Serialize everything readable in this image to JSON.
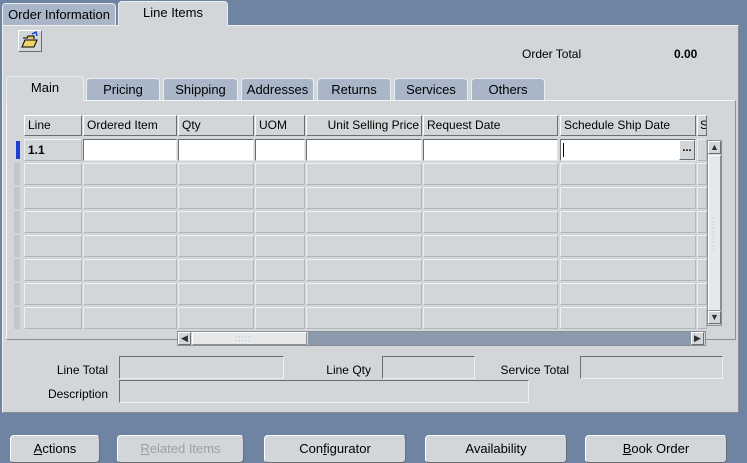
{
  "outer_tabs": [
    {
      "label": "Order Information",
      "active": false
    },
    {
      "label": "Line Items",
      "active": true
    }
  ],
  "toolbar": {
    "folder_icon": "open-folder-icon"
  },
  "order_total": {
    "label": "Order Total",
    "value": "0.00"
  },
  "inner_tabs": [
    {
      "label": "Main",
      "active": true
    },
    {
      "label": "Pricing"
    },
    {
      "label": "Shipping"
    },
    {
      "label": "Addresses"
    },
    {
      "label": "Returns"
    },
    {
      "label": "Services"
    },
    {
      "label": "Others"
    }
  ],
  "grid": {
    "columns": [
      "Line",
      "Ordered Item",
      "Qty",
      "UOM",
      "Unit Selling Price",
      "Request Date",
      "Schedule Ship Date",
      "S"
    ],
    "first_row": {
      "line": "1.1",
      "ordered_item": "",
      "qty": "",
      "uom": "",
      "unit_selling_price": "",
      "request_date": "",
      "schedule_ship_date": ""
    },
    "lov_button": "...",
    "empty_rows": 7
  },
  "footer_fields": {
    "line_total_label": "Line Total",
    "line_qty_label": "Line Qty",
    "service_total_label": "Service Total",
    "description_label": "Description",
    "line_total": "",
    "line_qty": "",
    "service_total": "",
    "description": ""
  },
  "buttons": {
    "actions": {
      "pre": "",
      "u": "A",
      "post": "ctions"
    },
    "related_items": {
      "pre": "",
      "u": "R",
      "post": "elated Items",
      "disabled": true
    },
    "configurator": {
      "pre": "Con",
      "u": "f",
      "post": "igurator"
    },
    "availability": {
      "pre": "Availability",
      "u": "",
      "post": ""
    },
    "book_order": {
      "pre": "",
      "u": "B",
      "post": "ook Order"
    }
  },
  "colors": {
    "background": "#6f83a2",
    "panel": "#d3d6d8",
    "tab_inactive": "#a9b6c8",
    "focus_marker": "#1d3fd0"
  }
}
